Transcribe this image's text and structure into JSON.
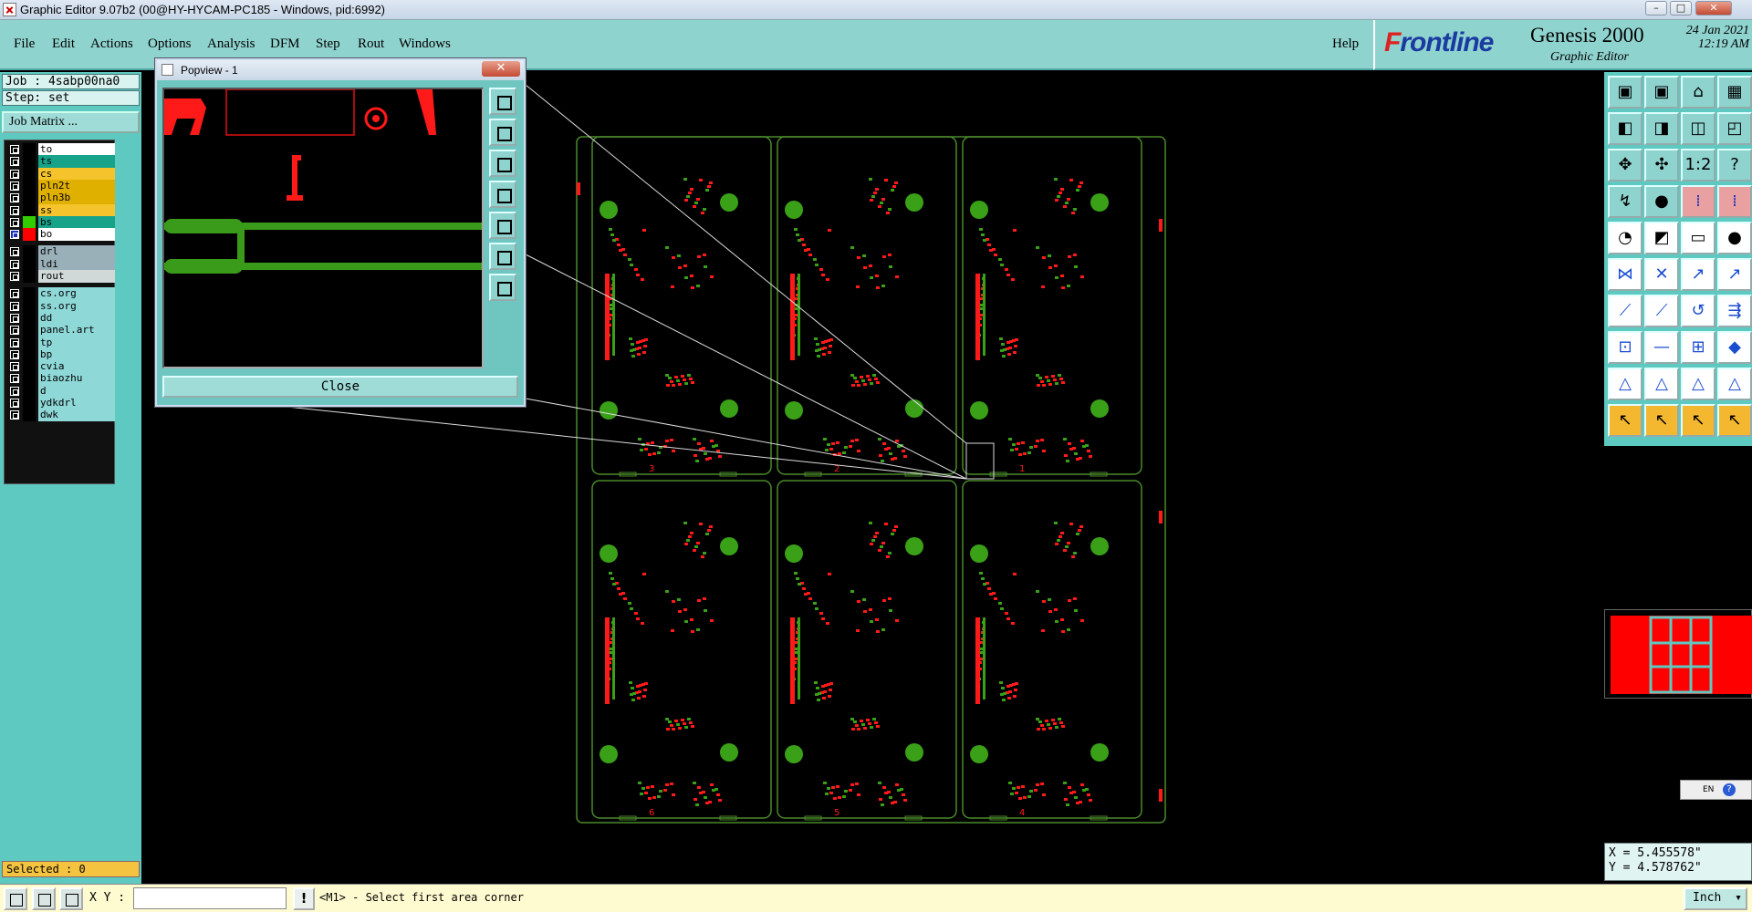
{
  "window": {
    "title": "Graphic Editor 9.07b2 (00@HY-HYCAM-PC185 - Windows, pid:6992)",
    "minimize": "–",
    "maximize": "□",
    "close": "✕"
  },
  "menu": {
    "items": [
      "File",
      "Edit",
      "Actions",
      "Options",
      "Analysis",
      "DFM",
      "Step",
      "Rout",
      "Windows"
    ],
    "help": "Help"
  },
  "brand": {
    "logo_prefix": "F",
    "logo_rest": "rontline",
    "product": "Genesis 2000",
    "subtitle": "Graphic Editor",
    "date": "24 Jan 2021",
    "time": "12:19 AM"
  },
  "job": {
    "job_line": "Job : 4sabp00na0",
    "step_line": "Step: set",
    "matrix_button": "Job Matrix ..."
  },
  "layers": [
    {
      "name": "to",
      "color": "#ffffff"
    },
    {
      "name": "ts",
      "color": "#16a38a"
    },
    {
      "name": "cs",
      "color": "#f5c32c"
    },
    {
      "name": "pln2t",
      "color": "#e0b000"
    },
    {
      "name": "pln3b",
      "color": "#e0b000"
    },
    {
      "name": "ss",
      "color": "#f5c32c"
    },
    {
      "name": "bs",
      "color": "#16a38a",
      "swatch": "#33cc00"
    },
    {
      "name": "bo",
      "color": "#ffffff",
      "swatch": "#ff0000",
      "active": true
    },
    {
      "name": "drl",
      "color": "#9ab0b8"
    },
    {
      "name": "ldi",
      "color": "#9ab0b8"
    },
    {
      "name": "rout",
      "color": "#d0d8d8"
    },
    {
      "name": "cs.org",
      "color": "#8fd8d8"
    },
    {
      "name": "ss.org",
      "color": "#8fd8d8"
    },
    {
      "name": "dd",
      "color": "#8fd8d8"
    },
    {
      "name": "panel.art",
      "color": "#8fd8d8"
    },
    {
      "name": "tp",
      "color": "#8fd8d8"
    },
    {
      "name": "bp",
      "color": "#8fd8d8"
    },
    {
      "name": "cvia",
      "color": "#8fd8d8"
    },
    {
      "name": "biaozhu",
      "color": "#8fd8d8"
    },
    {
      "name": "d",
      "color": "#8fd8d8"
    },
    {
      "name": "ydkdrl",
      "color": "#8fd8d8"
    },
    {
      "name": "dwk",
      "color": "#8fd8d8"
    }
  ],
  "selected": "Selected : 0",
  "popview": {
    "title": "Popview - 1",
    "close_label": "Close"
  },
  "pcb": {
    "panel_numbers": [
      "3",
      "2",
      "1",
      "6",
      "5",
      "4"
    ]
  },
  "coords": {
    "x": "X = 5.455578\"",
    "y": "Y = 4.578762\""
  },
  "language": {
    "label": "EN",
    "help": "?"
  },
  "status": {
    "xy_label": "X Y :",
    "xy_value": "",
    "message_icon": "!",
    "message": "<M1> - Select first area corner",
    "unit": "Inch"
  },
  "colors": {
    "panel": "#5ec9c0",
    "menubar": "#8fd3cf",
    "trace": "#3a9a1a",
    "copper_red": "#ff1010",
    "outline": "#4a8a2a"
  }
}
